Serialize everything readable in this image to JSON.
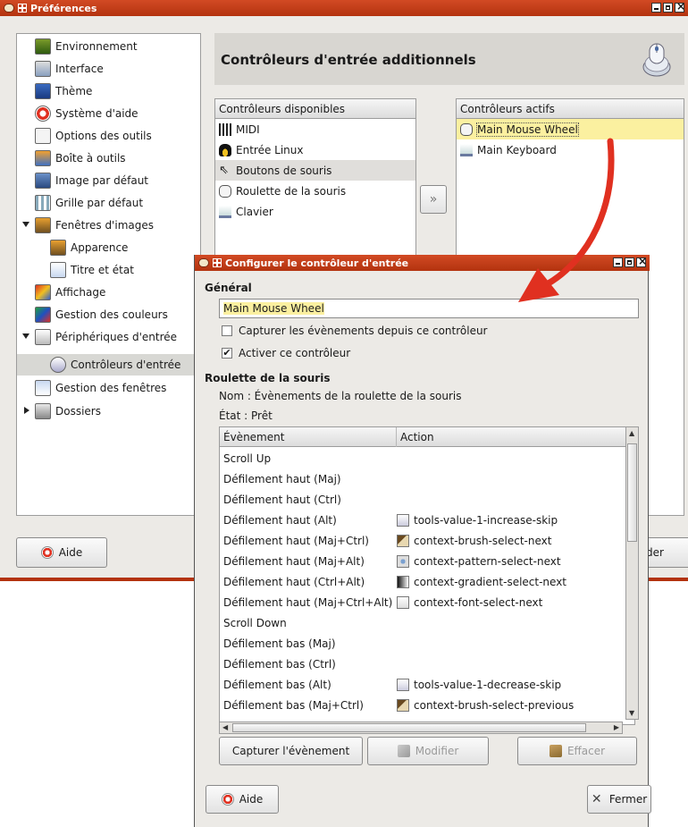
{
  "prefs_window": {
    "title": "Préférences",
    "page_title": "Contrôleurs d'entrée additionnels",
    "sidebar": [
      {
        "label": "Environnement"
      },
      {
        "label": "Interface"
      },
      {
        "label": "Thème"
      },
      {
        "label": "Système d'aide"
      },
      {
        "label": "Options des outils"
      },
      {
        "label": "Boîte à outils"
      },
      {
        "label": "Image par défaut"
      },
      {
        "label": "Grille par défaut"
      },
      {
        "label": "Fenêtres d'images"
      },
      {
        "label": "Apparence"
      },
      {
        "label": "Titre et état"
      },
      {
        "label": "Affichage"
      },
      {
        "label": "Gestion des couleurs"
      },
      {
        "label": "Périphériques d'entrée"
      },
      {
        "label": "Contrôleurs d'entrée"
      },
      {
        "label": "Gestion des fenêtres"
      },
      {
        "label": "Dossiers"
      }
    ],
    "available": {
      "header": "Contrôleurs disponibles",
      "items": [
        "MIDI",
        "Entrée Linux",
        "Boutons de souris",
        "Roulette de la souris",
        "Clavier"
      ]
    },
    "active": {
      "header": "Contrôleurs actifs",
      "items": [
        "Main Mouse Wheel",
        "Main Keyboard"
      ]
    },
    "help_button": "Aide",
    "fragment_button": "der"
  },
  "dialog": {
    "title": "Configurer le contrôleur d'entrée",
    "general_section": "Général",
    "name_value": "Main Mouse Wheel",
    "capture_checkbox": "Capturer les évènements depuis ce contrôleur",
    "capture_checked": false,
    "enable_checkbox": "Activer ce contrôleur",
    "enable_checked": true,
    "wheel_section": "Roulette de la souris",
    "name_info": "Nom : Évènements de la roulette de la souris",
    "state_info": "État : Prêt",
    "columns": [
      "Évènement",
      "Action"
    ],
    "events": [
      {
        "event": "Scroll Up",
        "action": ""
      },
      {
        "event": "Défilement haut (Maj)",
        "action": ""
      },
      {
        "event": "Défilement haut (Ctrl)",
        "action": ""
      },
      {
        "event": "Défilement haut (Alt)",
        "action": "tools-value-1-increase-skip",
        "icon": "value-icon"
      },
      {
        "event": "Défilement haut (Maj+Ctrl)",
        "action": "context-brush-select-next",
        "icon": "brush-icon"
      },
      {
        "event": "Défilement haut (Maj+Alt)",
        "action": "context-pattern-select-next",
        "icon": "pattern-icon"
      },
      {
        "event": "Défilement haut (Ctrl+Alt)",
        "action": "context-gradient-select-next",
        "icon": "gradient-icon"
      },
      {
        "event": "Défilement haut (Maj+Ctrl+Alt)",
        "action": "context-font-select-next",
        "icon": "font-icon"
      },
      {
        "event": "Scroll Down",
        "action": ""
      },
      {
        "event": "Défilement bas (Maj)",
        "action": ""
      },
      {
        "event": "Défilement bas (Ctrl)",
        "action": ""
      },
      {
        "event": "Défilement bas (Alt)",
        "action": "tools-value-1-decrease-skip",
        "icon": "value-icon"
      },
      {
        "event": "Défilement bas (Maj+Ctrl)",
        "action": "context-brush-select-previous",
        "icon": "brush-icon"
      }
    ],
    "capture_button": "Capturer l'évènement",
    "modify_button": "Modifier",
    "clear_button": "Effacer",
    "help_button": "Aide",
    "close_button": "Fermer"
  },
  "colors": {
    "titlebar": "#c23c19",
    "selection": "#fbf0a0",
    "arrow": "#e03020"
  }
}
